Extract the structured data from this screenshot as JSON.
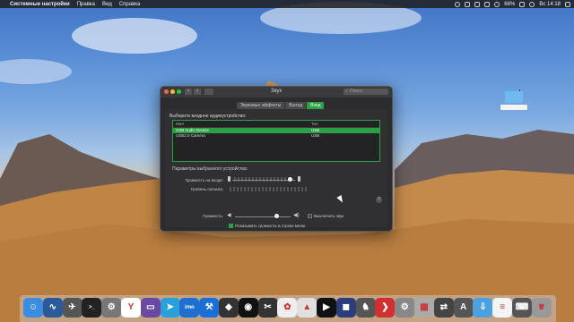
{
  "menubar": {
    "apple": "",
    "app_name": "Системные настройки",
    "items": [
      "Правка",
      "Вид",
      "Справка"
    ],
    "battery": "66%",
    "clock": "Вс 14:18"
  },
  "window": {
    "title": "Звук",
    "search_placeholder": "Поиск",
    "tabs": [
      "Звуковые эффекты",
      "Выход",
      "Вход"
    ],
    "active_tab": "Вход",
    "heading": "Выберите входное аудиоустройство:",
    "columns": [
      "Имя",
      "Тип"
    ],
    "devices": [
      {
        "name": "USB Audio Device",
        "type": "USB",
        "selected": true
      },
      {
        "name": "USB2.0 Camera",
        "type": "USB",
        "selected": false
      }
    ],
    "params_title": "Параметры выбранного устройства:",
    "input_volume_label": "Громкость на входе:",
    "input_volume_level": 0.8,
    "signal_level_label": "Уровень сигнала:",
    "help": "?",
    "output_volume_label": "Громкость:",
    "output_volume_level": 0.7,
    "mute_label": "Выключить звук",
    "mute_checked": false,
    "show_in_menubar_label": "Показывать громкость в строке меню",
    "show_in_menubar_checked": true
  },
  "dock": {
    "apps": [
      {
        "name": "finder",
        "glyph": "☺",
        "color": "#3b8de0"
      },
      {
        "name": "activity-monitor",
        "glyph": "∿",
        "color": "#2a5a9a"
      },
      {
        "name": "launchpad",
        "glyph": "✈",
        "color": "#555"
      },
      {
        "name": "terminal",
        "glyph": ">_",
        "color": "#222"
      },
      {
        "name": "system-gear",
        "glyph": "⚙",
        "color": "#777"
      },
      {
        "name": "yandex-browser",
        "glyph": "Y",
        "color": "#fff"
      },
      {
        "name": "folder-app",
        "glyph": "▭",
        "color": "#6a4aa0"
      },
      {
        "name": "telegram",
        "glyph": "➤",
        "color": "#2aa0da"
      },
      {
        "name": "imo",
        "glyph": "imo",
        "color": "#1f6fd0"
      },
      {
        "name": "xcode",
        "glyph": "⚒",
        "color": "#1b6ed6"
      },
      {
        "name": "shortcuts",
        "glyph": "◆",
        "color": "#333"
      },
      {
        "name": "obs",
        "glyph": "◉",
        "color": "#111"
      },
      {
        "name": "final-cut",
        "glyph": "✂",
        "color": "#333"
      },
      {
        "name": "photos",
        "glyph": "✿",
        "color": "#eee"
      },
      {
        "name": "keynote",
        "glyph": "▲",
        "color": "#e0e0e0"
      },
      {
        "name": "video-player",
        "glyph": "▶",
        "color": "#111"
      },
      {
        "name": "media-app",
        "glyph": "◼",
        "color": "#2b3d7a"
      },
      {
        "name": "chess",
        "glyph": "♞",
        "color": "#555"
      },
      {
        "name": "remote-desktop",
        "glyph": "❯",
        "color": "#d03030"
      },
      {
        "name": "system-preferences",
        "glyph": "⚙",
        "color": "#888"
      },
      {
        "name": "scanner",
        "glyph": "▦",
        "color": "#aaa"
      },
      {
        "name": "migration",
        "glyph": "⇄",
        "color": "#444"
      },
      {
        "name": "app-store",
        "glyph": "A",
        "color": "#555"
      },
      {
        "name": "downloads-folder",
        "glyph": "⇩",
        "color": "#4aa0e0"
      },
      {
        "name": "text-document",
        "glyph": "≡",
        "color": "#f4f4f4"
      },
      {
        "name": "keyboard",
        "glyph": "⌨",
        "color": "#555"
      },
      {
        "name": "trash",
        "glyph": "🗑",
        "color": "#999"
      }
    ]
  }
}
